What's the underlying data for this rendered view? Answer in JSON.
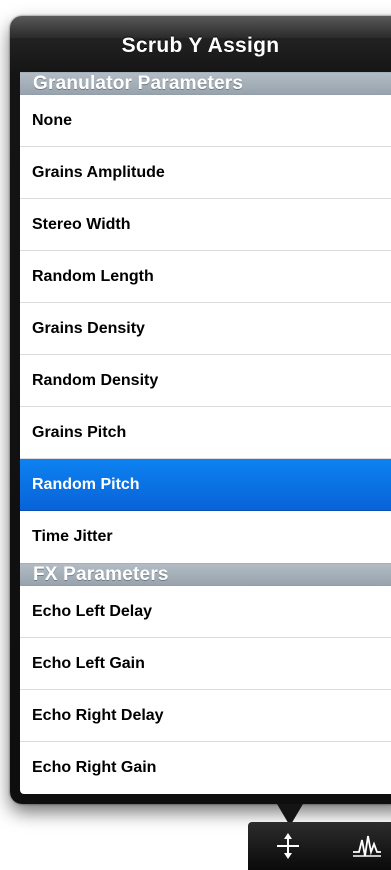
{
  "popover": {
    "title": "Scrub Y Assign"
  },
  "sections": [
    {
      "header": "Granulator Parameters",
      "rows": [
        {
          "label": "None",
          "selected": false
        },
        {
          "label": "Grains Amplitude",
          "selected": false
        },
        {
          "label": "Stereo Width",
          "selected": false
        },
        {
          "label": "Random Length",
          "selected": false
        },
        {
          "label": "Grains Density",
          "selected": false
        },
        {
          "label": "Random Density",
          "selected": false
        },
        {
          "label": "Grains Pitch",
          "selected": false
        },
        {
          "label": "Random Pitch",
          "selected": true
        },
        {
          "label": "Time Jitter",
          "selected": false
        }
      ]
    },
    {
      "header": "FX Parameters",
      "rows": [
        {
          "label": "Echo Left Delay",
          "selected": false
        },
        {
          "label": "Echo Left Gain",
          "selected": false
        },
        {
          "label": "Echo Right Delay",
          "selected": false
        },
        {
          "label": "Echo Right Gain",
          "selected": false
        }
      ]
    }
  ],
  "toolbar": {
    "icons": [
      "vertical-scrub-icon",
      "waveform-icon"
    ]
  },
  "colors": {
    "selection": "#0a6fe4",
    "section_header": "#a6afb8",
    "popover_frame": "#141414"
  }
}
